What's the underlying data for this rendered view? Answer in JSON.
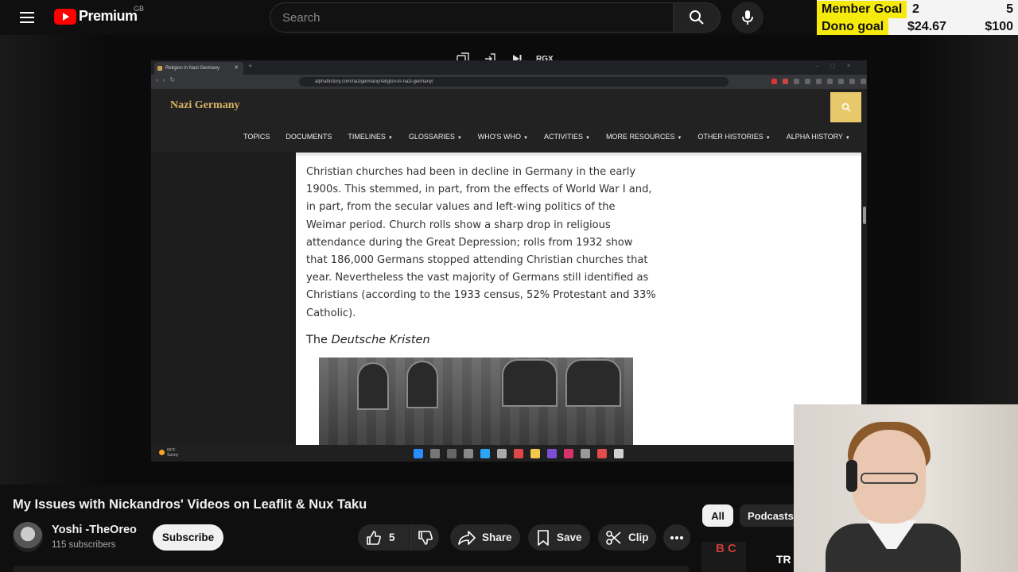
{
  "header": {
    "logo_text": "Premium",
    "region": "GB",
    "search_placeholder": "Search"
  },
  "goals": {
    "member": {
      "label": "Member Goal",
      "current": "2",
      "target": "5"
    },
    "dono": {
      "label": "Dono goal",
      "current": "$24.67",
      "target": "$100"
    }
  },
  "recorder_controls": {
    "label": "RGX"
  },
  "browser": {
    "tab_title": "Religion in Nazi Germany",
    "url": "alphahistory.com/nazigermany/religion-in-nazi-germany/",
    "site_name": "Nazi Germany",
    "nav": [
      {
        "label": "TOPICS",
        "dropdown": false
      },
      {
        "label": "DOCUMENTS",
        "dropdown": false
      },
      {
        "label": "TIMELINES",
        "dropdown": true
      },
      {
        "label": "GLOSSARIES",
        "dropdown": true
      },
      {
        "label": "WHO'S WHO",
        "dropdown": true
      },
      {
        "label": "ACTIVITIES",
        "dropdown": true
      },
      {
        "label": "MORE RESOURCES",
        "dropdown": true
      },
      {
        "label": "OTHER HISTORIES",
        "dropdown": true
      },
      {
        "label": "ALPHA HISTORY",
        "dropdown": true
      }
    ],
    "article": {
      "paragraph": "Christian churches had been in decline in Germany in the early 1900s. This stemmed, in part, from the effects of World War I and, in part, from the secular values and left-wing politics of the Weimar period. Church rolls show a sharp drop in religious attendance during the Great Depression; rolls from 1932 show that 186,000 Germans stopped attending Christian churches that year. Nevertheless the vast majority of Germans still identified as Christians (according to the 1933 census, 52% Protestant and 33% Catholic).",
      "heading_prefix": "The",
      "heading_italic": "Deutsche Kristen"
    },
    "taskbar_weather": {
      "temp": "66°F",
      "condition": "Sunny"
    }
  },
  "video": {
    "title": "My Issues with Nickandros' Videos on Leaflit & Nux Taku",
    "channel": "Yoshi -TheOreo",
    "subscribers": "115 subscribers",
    "subscribe_label": "Subscribe",
    "likes": "5",
    "share_label": "Share",
    "save_label": "Save",
    "clip_label": "Clip"
  },
  "chips": {
    "all": "All",
    "podcasts": "Podcasts"
  },
  "sidebar_peek": {
    "thumb1": "B C",
    "thumb2": "TR"
  },
  "colors": {
    "accent_red": "#ff0000",
    "goal_yellow": "#f6ea0c",
    "site_gold": "#d8b364"
  }
}
